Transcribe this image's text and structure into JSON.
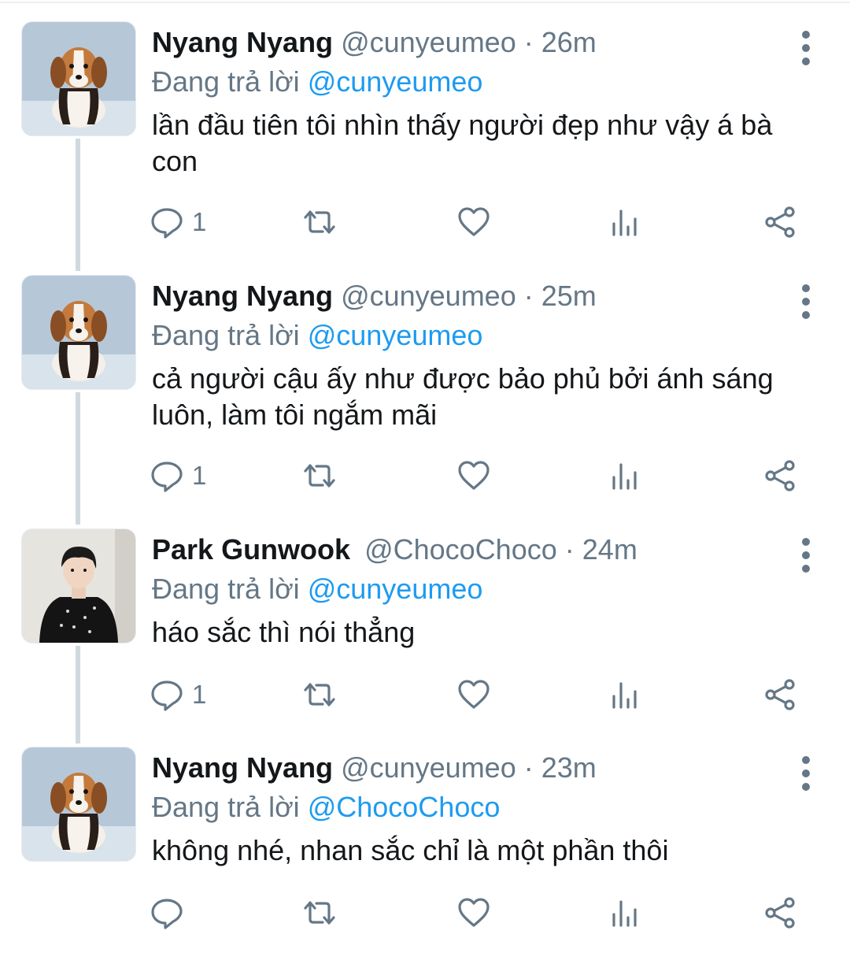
{
  "thread": {
    "tweets": [
      {
        "name": "Nyang Nyang",
        "handle": "@cunyeumeo",
        "separator": "·",
        "time": "26m",
        "reply_prefix": "Đang trả lời",
        "reply_target": "@cunyeumeo",
        "text": "lần đầu tiên tôi nhìn thấy người đẹp như vậy á bà con",
        "reply_count": "1",
        "avatar": "beagle-puppy"
      },
      {
        "name": "Nyang Nyang",
        "handle": "@cunyeumeo",
        "separator": "·",
        "time": "25m",
        "reply_prefix": "Đang trả lời",
        "reply_target": "@cunyeumeo",
        "text": "cả người cậu ấy như được bảo phủ bởi ánh sáng luôn, làm tôi ngắm mãi",
        "reply_count": "1",
        "avatar": "beagle-puppy"
      },
      {
        "name": "Park Gunwook",
        "handle": "@ChocoChoco",
        "separator": "·",
        "time": "24m",
        "reply_prefix": "Đang trả lời",
        "reply_target": "@cunyeumeo",
        "text": "háo sắc thì nói thẳng",
        "reply_count": "1",
        "avatar": "person-in-black-sweater"
      },
      {
        "name": "Nyang Nyang",
        "handle": "@cunyeumeo",
        "separator": "·",
        "time": "23m",
        "reply_prefix": "Đang trả lời",
        "reply_target": "@ChocoChoco",
        "text": "không nhé, nhan sắc chỉ là một phần thôi",
        "reply_count": "",
        "avatar": "beagle-puppy"
      }
    ]
  },
  "colors": {
    "link": "#1d9bf0",
    "secondary_text": "#657786",
    "primary_text": "#14171a",
    "thread_line": "#cfd9de"
  },
  "icons": {
    "reply": "speech-bubble-icon",
    "retweet": "retweet-arrows-icon",
    "like": "heart-outline-icon",
    "stats": "bar-chart-icon",
    "share": "share-nodes-icon",
    "menu": "vertical-ellipsis-icon"
  }
}
